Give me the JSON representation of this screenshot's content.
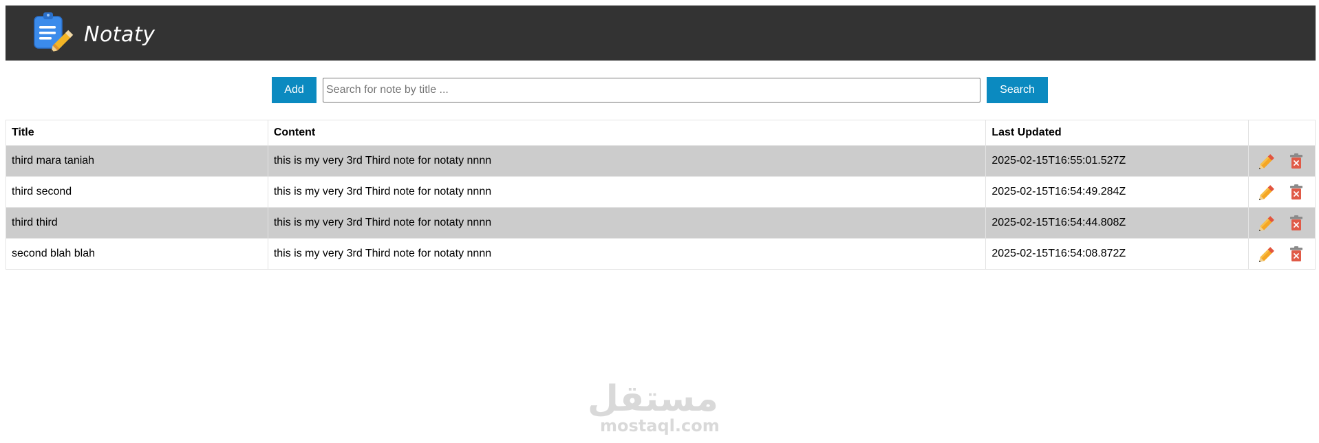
{
  "header": {
    "logo_icon": "clipboard-pencil-icon",
    "logo_text": "Notaty",
    "background_color": "#333333"
  },
  "toolbar": {
    "add_label": "Add",
    "search_placeholder": "Search for note by title ...",
    "search_value": "",
    "search_label": "Search",
    "accent_color": "#0b8ac0"
  },
  "table": {
    "columns": [
      "Title",
      "Content",
      "Last Updated",
      ""
    ],
    "rows": [
      {
        "title": "third mara taniah",
        "content": "this is my very 3rd Third note for notaty nnnn",
        "last_updated": "2025-02-15T16:55:01.527Z"
      },
      {
        "title": "third second",
        "content": "this is my very 3rd Third note for notaty nnnn",
        "last_updated": "2025-02-15T16:54:49.284Z"
      },
      {
        "title": "third third",
        "content": "this is my very 3rd Third note for notaty nnnn",
        "last_updated": "2025-02-15T16:54:44.808Z"
      },
      {
        "title": "second blah blah",
        "content": "this is my very 3rd Third note for notaty nnnn",
        "last_updated": "2025-02-15T16:54:08.872Z"
      }
    ],
    "row_actions": [
      "pencil-icon",
      "trash-icon"
    ],
    "stripe_color": "#cccccc"
  },
  "watermark": {
    "arabic": "مستقل",
    "latin": "mostaql.com"
  }
}
